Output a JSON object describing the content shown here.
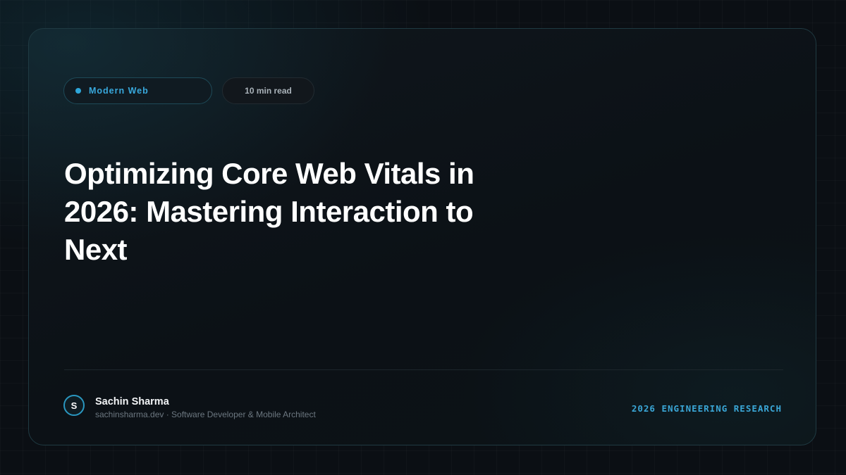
{
  "colors": {
    "accent": "#2ea6d9",
    "background": "#0b0f14",
    "card_border": "#1f3a42",
    "title": "#ffffff"
  },
  "tags": {
    "topic": "Modern Web",
    "topic_icon": "dot-indicator",
    "read_time": "10 min read"
  },
  "article": {
    "title": "Optimizing Core Web Vitals in 2026: Mastering Interaction to Next"
  },
  "author": {
    "avatar_initial": "S",
    "name": "Sachin Sharma",
    "meta": "sachinsharma.dev · Software Developer & Mobile Architect"
  },
  "footer": {
    "label": "2026 ENGINEERING RESEARCH"
  }
}
